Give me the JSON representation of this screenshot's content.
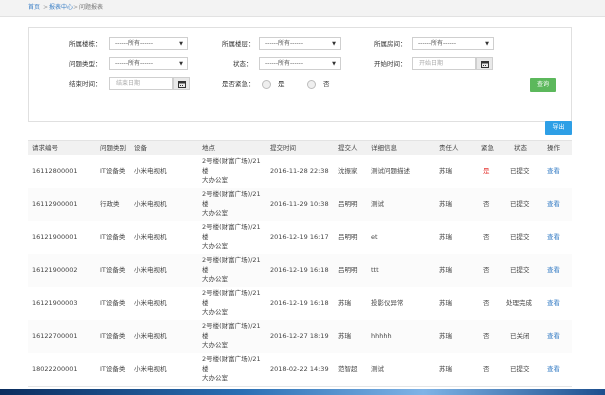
{
  "breadcrumb": [
    "首页",
    "报表中心",
    "问题报表"
  ],
  "filters": {
    "building_label": "所属楼栋：",
    "building_value": "------所有------",
    "floor_label": "所属楼层：",
    "floor_value": "------所有------",
    "room_label": "所属房间：",
    "room_value": "------所有------",
    "type_label": "问题类型：",
    "type_value": "------所有------",
    "status_label": "状态：",
    "status_value": "------所有------",
    "start_label": "开始时间：",
    "start_placeholder": "开始日期",
    "end_label": "结束时间：",
    "end_placeholder": "结束日期",
    "urgent_label": "是否紧急：",
    "urgent_yes": "是",
    "urgent_no": "否",
    "query_button": "查询"
  },
  "export_button": "导出",
  "table": {
    "columns": [
      "请求编号",
      "问题类别",
      "设备",
      "地点",
      "提交时间",
      "提交人",
      "详细信息",
      "责任人",
      "紧急",
      "状态",
      "操作"
    ],
    "rows": [
      {
        "id": "16112800001",
        "category": "IT设备类",
        "device": "小米电视机",
        "loc1": "2号楼(财富广场)/21",
        "loc2": "楼",
        "loc3": "大办公室",
        "time": "2016-11-28 22:38",
        "submitter": "沈振家",
        "detail": "测试问题描述",
        "owner": "苏瑞",
        "urgent": "是",
        "status": "已提交",
        "action": "查看"
      },
      {
        "id": "16112900001",
        "category": "行政类",
        "device": "小米电视机",
        "loc1": "2号楼(财富广场)/21",
        "loc2": "楼",
        "loc3": "大办公室",
        "time": "2016-11-29 10:38",
        "submitter": "吕明明",
        "detail": "测试",
        "owner": "苏瑞",
        "urgent": "否",
        "status": "已提交",
        "action": "查看"
      },
      {
        "id": "16121900001",
        "category": "IT设备类",
        "device": "小米电视机",
        "loc1": "2号楼(财富广场)/21",
        "loc2": "楼",
        "loc3": "大办公室",
        "time": "2016-12-19 16:17",
        "submitter": "吕明明",
        "detail": "et",
        "owner": "苏瑞",
        "urgent": "否",
        "status": "已提交",
        "action": "查看"
      },
      {
        "id": "16121900002",
        "category": "IT设备类",
        "device": "小米电视机",
        "loc1": "2号楼(财富广场)/21",
        "loc2": "楼",
        "loc3": "大办公室",
        "time": "2016-12-19 16:18",
        "submitter": "吕明明",
        "detail": "ttt",
        "owner": "苏瑞",
        "urgent": "否",
        "status": "已提交",
        "action": "查看"
      },
      {
        "id": "16121900003",
        "category": "IT设备类",
        "device": "小米电视机",
        "loc1": "2号楼(财富广场)/21",
        "loc2": "楼",
        "loc3": "大办公室",
        "time": "2016-12-19 16:18",
        "submitter": "苏瑞",
        "detail": "投影仪异常",
        "owner": "苏瑞",
        "urgent": "否",
        "status": "处理完成",
        "action": "查看"
      },
      {
        "id": "16122700001",
        "category": "IT设备类",
        "device": "小米电视机",
        "loc1": "2号楼(财富广场)/21",
        "loc2": "楼",
        "loc3": "大办公室",
        "time": "2016-12-27 18:19",
        "submitter": "苏瑞",
        "detail": "hhhhh",
        "owner": "苏瑞",
        "urgent": "否",
        "status": "已关闭",
        "action": "查看"
      },
      {
        "id": "18022200001",
        "category": "IT设备类",
        "device": "小米电视机",
        "loc1": "2号楼(财富广场)/21",
        "loc2": "楼",
        "loc3": "大办公室",
        "time": "2018-02-22 14:39",
        "submitter": "范智超",
        "detail": "测试",
        "owner": "苏瑞",
        "urgent": "否",
        "status": "已提交",
        "action": "查看"
      }
    ]
  },
  "colors": {
    "link": "#3a7fc6",
    "query": "#5cb85c",
    "export": "#2e9fe6",
    "urgent_yes": "#e53935"
  },
  "icons": {
    "calendar": "calendar-icon",
    "dropdown": "chevron-down-icon"
  }
}
